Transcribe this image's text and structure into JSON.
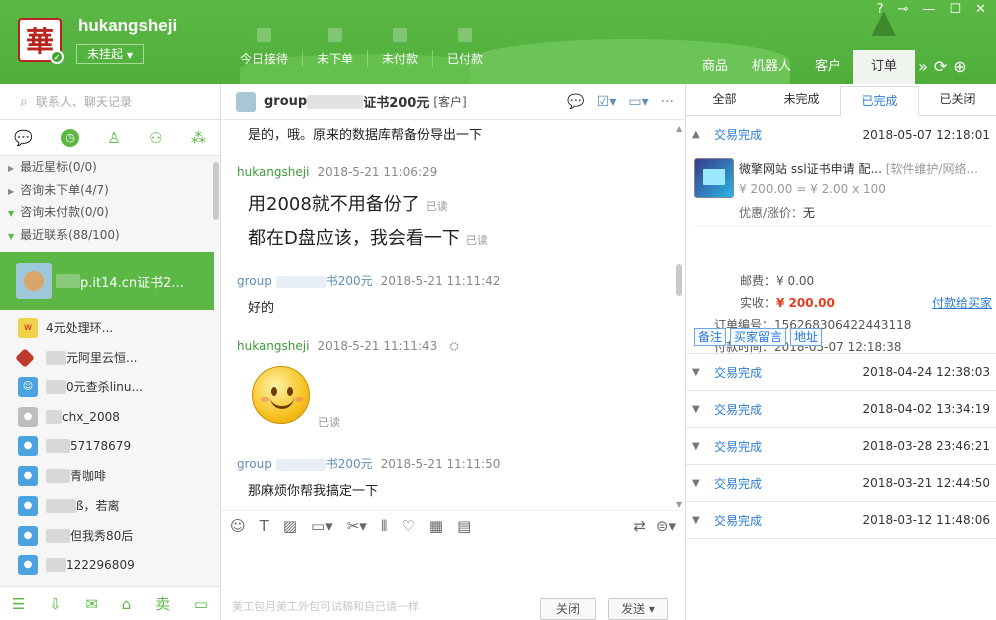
{
  "header": {
    "username": "hukangsheji",
    "avatar_char": "華",
    "status": "未挂起",
    "nav": [
      "今日接待",
      "未下单",
      "未付款",
      "已付款"
    ],
    "right_tabs": [
      "商品",
      "机器人",
      "客户",
      "订单"
    ],
    "window_controls": [
      "help-icon",
      "pin-icon",
      "minimize-icon",
      "maximize-icon",
      "close-icon"
    ]
  },
  "sidebar": {
    "search_placeholder": "联系人、聊天记录",
    "categories": [
      "最近星标(0/0)",
      "咨询未下单(4/7)",
      "咨询未付款(0/0)",
      "最近联系(88/100)"
    ],
    "selected_contact": "p.it14.cn证书2...",
    "contacts": [
      "4元处理环...",
      "元阿里云恒...",
      "0元查杀linu...",
      "chx_2008",
      "57178679",
      "青咖啡",
      "ß，若离",
      "但我秀80后",
      "122296809"
    ]
  },
  "chat": {
    "title": "group",
    "title_suffix": "证书200元",
    "title_tag": "[客户]",
    "messages": [
      {
        "text": "是的，哦。原来的数据库帮备份导出一下"
      },
      {
        "sender": "hukangsheji",
        "time": "2018-5-21 11:06:29"
      },
      {
        "text": "用2008就不用备份了",
        "read": "已读"
      },
      {
        "text": "都在D盘应该，我会看一下",
        "read": "已读"
      },
      {
        "sender": "group",
        "sender_suffix": "书200元",
        "time": "2018-5-21 11:11:42"
      },
      {
        "text": "好的"
      },
      {
        "sender": "hukangsheji",
        "time": "2018-5-21 11:11:43"
      },
      {
        "read": "已读"
      },
      {
        "sender": "group",
        "sender_suffix": "书200元",
        "time": "2018-5-21 11:11:50"
      },
      {
        "text": "那麻烦你帮我搞定一下"
      }
    ],
    "input_placeholder": "美工包月美工外包可试稿和自己请一样",
    "close_label": "关闭",
    "send_label": "发送"
  },
  "orders": {
    "tabs": [
      "全部",
      "未完成",
      "已完成",
      "已关闭"
    ],
    "expanded": {
      "status": "交易完成",
      "date": "2018-05-07 12:18:01",
      "product_title": "微擎网站 ssl证书申请 配...",
      "product_tag": "[软件维护/网络...",
      "price_line": "¥ 200.00 = ¥ 2.00 x 100",
      "discount_label": "优惠/涨价：",
      "discount_value": "无",
      "shipping_label": "邮费：",
      "shipping_value": "¥ 0.00",
      "paid_label": "实收：",
      "paid_value": "¥ 200.00",
      "pay_link": "付款给买家",
      "order_no_label": "订单编号：",
      "order_no": "156268306422443118",
      "pay_time_label": "付款时间：",
      "pay_time": "2018-05-07 12:18:38",
      "buttons": [
        "备注",
        "买家留言",
        "地址"
      ]
    },
    "list": [
      {
        "status": "交易完成",
        "date": "2018-04-24 12:38:03"
      },
      {
        "status": "交易完成",
        "date": "2018-04-02 13:34:19"
      },
      {
        "status": "交易完成",
        "date": "2018-03-28 23:46:21"
      },
      {
        "status": "交易完成",
        "date": "2018-03-21 12:44:50"
      },
      {
        "status": "交易完成",
        "date": "2018-03-12 11:48:06"
      }
    ]
  },
  "colors": {
    "brand_green": "#5cb845",
    "link_blue": "#2b7bd4",
    "price_red": "#e83b1e"
  }
}
